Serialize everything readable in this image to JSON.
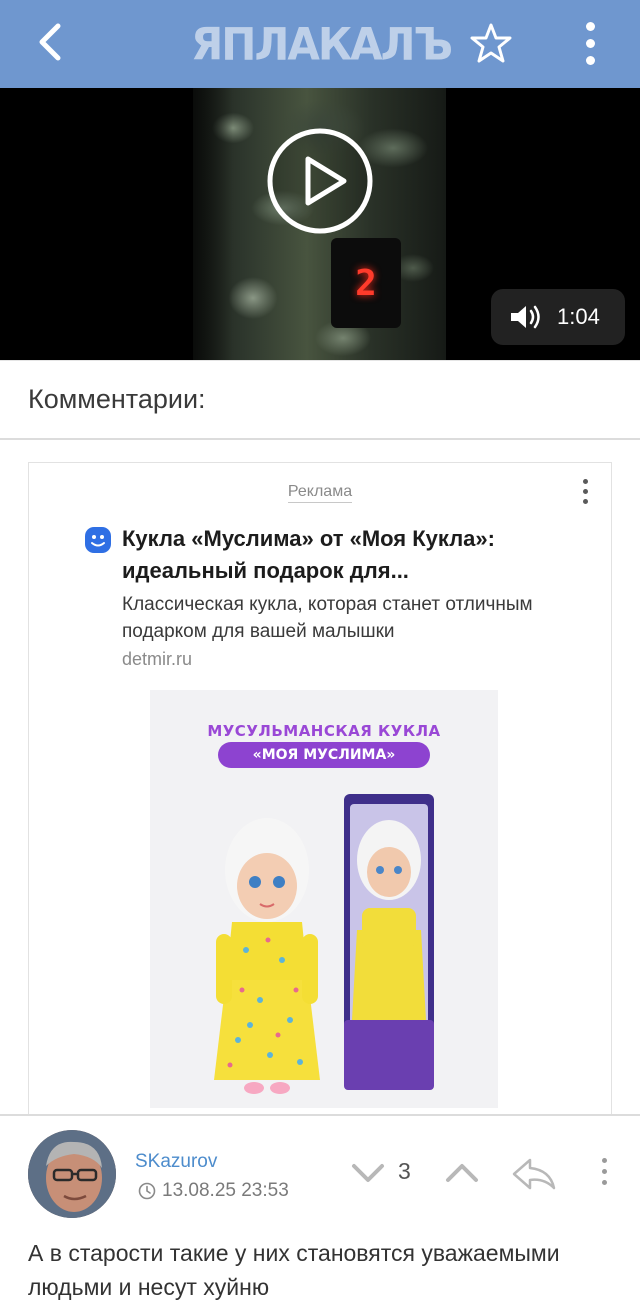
{
  "header": {
    "logo_text": "ЯПЛАКАЛЪ",
    "back_icon": "chevron-left-icon",
    "favorite_icon": "star-icon",
    "menu_icon": "more-vertical-icon",
    "bar_color": "#6f97cf"
  },
  "video": {
    "display_digit": "2",
    "duration": "1:04",
    "play_icon": "play-icon",
    "volume_icon": "volume-icon"
  },
  "comments": {
    "heading": "Комментарии:"
  },
  "ad": {
    "label": "Реклама",
    "title": "Кукла «Муслима» от «Моя Кукла»: идеальный подарок для...",
    "description": "Классическая кукла, которая станет отличным подарком для вашей малышки",
    "domain": "detmir.ru",
    "image_banner_line1": "МУСУЛЬМАНСКАЯ КУКЛА",
    "image_banner_line2": "«МОЯ МУСЛИМА»"
  },
  "comment": {
    "username": "SKazurov",
    "date": "13.08.25 23:53",
    "rating": "3",
    "text": "А в старости такие у них становятся уважаемыми людьми и несут хуйню"
  }
}
